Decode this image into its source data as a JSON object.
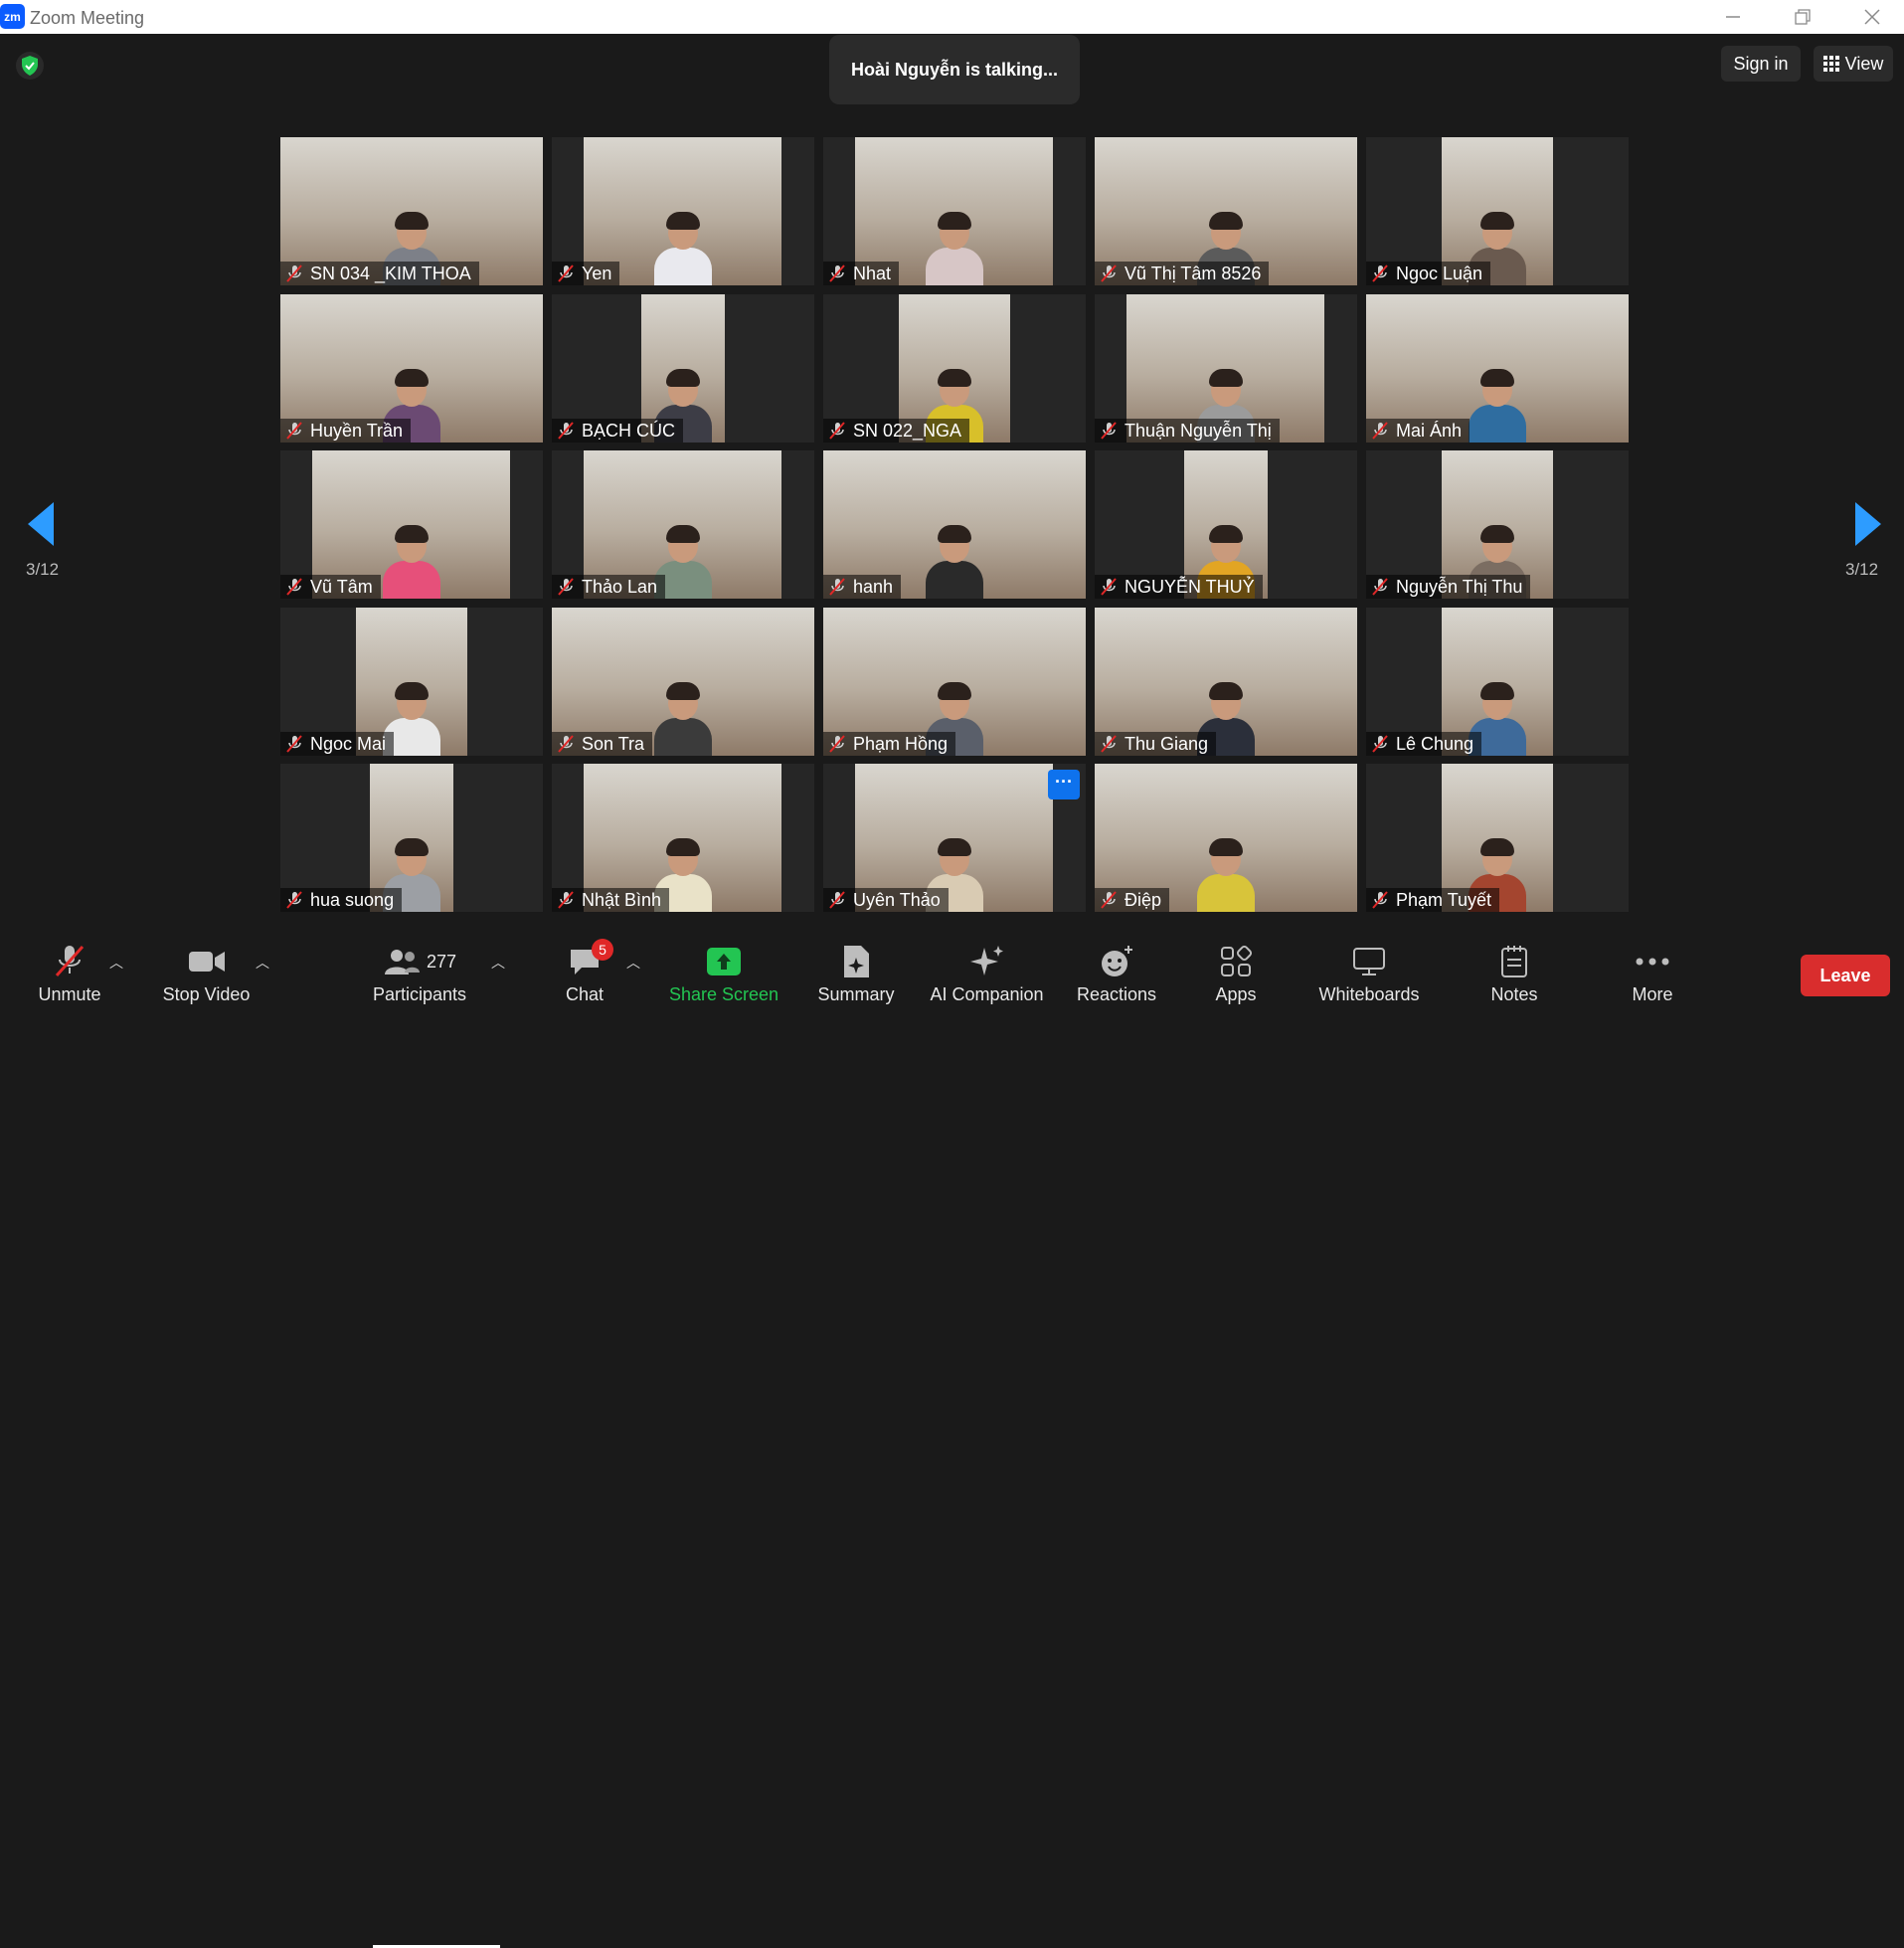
{
  "titlebar": {
    "logo": "zm",
    "title": "Zoom Meeting",
    "icons": [
      "minimize-icon",
      "restore-icon",
      "close-icon"
    ]
  },
  "top": {
    "talking_notice": "Hoài Nguyễn is talking...",
    "sign_in": "Sign in",
    "view": "View",
    "security_color": "#23c552"
  },
  "pagination": {
    "left_label": "3/12",
    "right_label": "3/12",
    "arrow_color": "#2d9cff"
  },
  "participants": [
    {
      "name": "SN 034 _KIM THOA"
    },
    {
      "name": "Yen"
    },
    {
      "name": "Nhat"
    },
    {
      "name": "Vũ Thị Tâm 8526"
    },
    {
      "name": "Ngoc Luận"
    },
    {
      "name": "Huyền Trần"
    },
    {
      "name": "BẠCH CÚC"
    },
    {
      "name": "SN 022_NGA"
    },
    {
      "name": "Thuận Nguyễn Thị"
    },
    {
      "name": "Mai Ánh"
    },
    {
      "name": "Vũ Tâm"
    },
    {
      "name": "Thảo Lan"
    },
    {
      "name": "hanh"
    },
    {
      "name": "NGUYỄN THUỶ"
    },
    {
      "name": "Nguyễn Thị Thu"
    },
    {
      "name": "Ngoc Mai"
    },
    {
      "name": "Son Tra"
    },
    {
      "name": "Phạm Hồng"
    },
    {
      "name": "Thu Giang"
    },
    {
      "name": "Lê Chung"
    },
    {
      "name": "hua suong"
    },
    {
      "name": "Nhật Bình"
    },
    {
      "name": "Uyên Thảo",
      "menu": "···"
    },
    {
      "name": "Điệp"
    },
    {
      "name": "Phạm Tuyết"
    }
  ],
  "toolbar": {
    "unmute": "Unmute",
    "stop_video": "Stop Video",
    "participants_label": "Participants",
    "participants_count": "277",
    "chat": "Chat",
    "chat_badge": "5",
    "share_screen": "Share Screen",
    "summary": "Summary",
    "ai_companion": "AI Companion",
    "reactions": "Reactions",
    "apps": "Apps",
    "whiteboards": "Whiteboards",
    "notes": "Notes",
    "more": "More",
    "leave": "Leave",
    "share_color": "#23c552",
    "leave_color": "#d92d2d"
  }
}
